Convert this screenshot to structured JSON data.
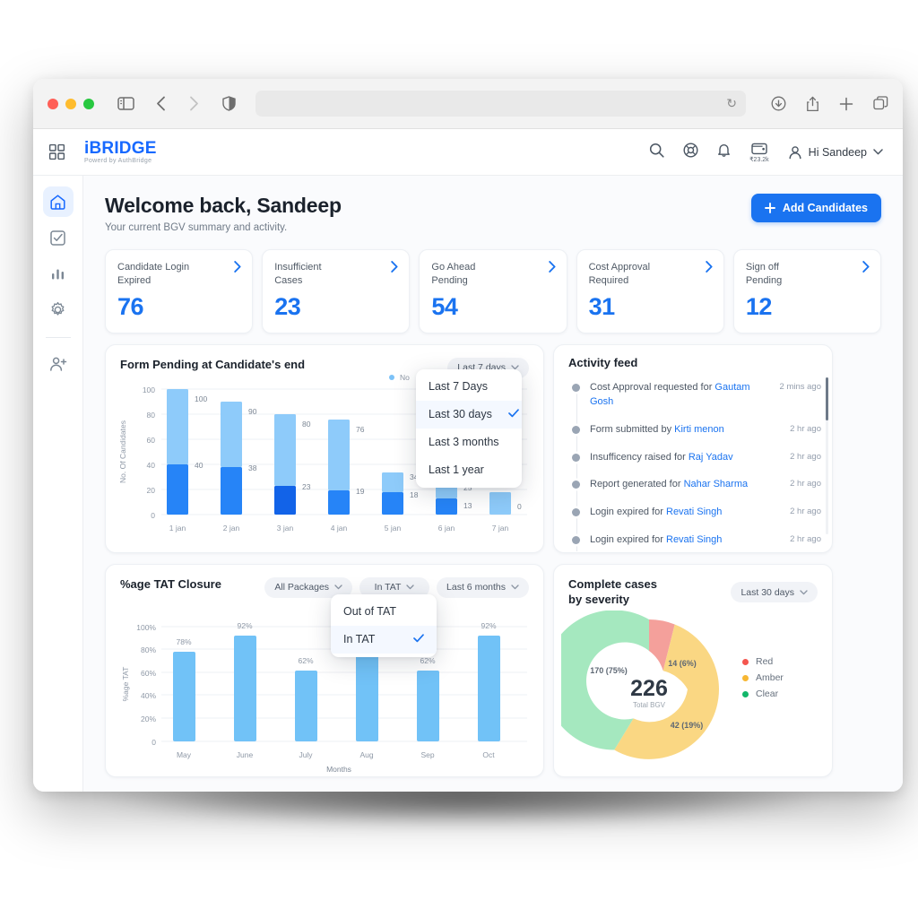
{
  "browser": {
    "url_value": "",
    "reload_icon": "reload-icon",
    "icons": [
      "sidebar-icon",
      "back-icon",
      "forward-icon",
      "shield-icon",
      "download-icon",
      "share-icon",
      "new-tab-icon",
      "tabs-icon"
    ]
  },
  "header": {
    "grid_icon": "grid-icon",
    "brand_name": "iBRIDGE",
    "brand_tagline": "Powerd by AuthBridge",
    "wallet_amount": "₹23.2k",
    "user_greeting": "Hi Sandeep",
    "icons": [
      "search-icon",
      "help-icon",
      "bell-icon",
      "wallet-icon",
      "user-icon",
      "chevron-down-icon"
    ]
  },
  "sidebar": {
    "items": [
      {
        "name": "home",
        "icon": "home-icon",
        "active": true
      },
      {
        "name": "tasks",
        "icon": "checkbox-task-icon",
        "active": false
      },
      {
        "name": "reports",
        "icon": "bar-chart-icon",
        "active": false
      },
      {
        "name": "settings",
        "icon": "gear-icon",
        "active": false
      },
      {
        "name": "add-user",
        "icon": "add-user-icon",
        "active": false
      }
    ]
  },
  "welcome": {
    "title": "Welcome back, Sandeep",
    "subtitle": "Your current BGV summary and activity.",
    "add_button": "Add Candidates"
  },
  "kpis": [
    {
      "label": "Candidate Login\nExpired",
      "value": "76"
    },
    {
      "label": "Insufficient\nCases",
      "value": "23"
    },
    {
      "label": "Go Ahead\nPending",
      "value": "54"
    },
    {
      "label": "Cost Approval\nRequired",
      "value": "31"
    },
    {
      "label": "Sign off\nPending",
      "value": "12"
    }
  ],
  "form_pending": {
    "title": "Form Pending at Candidate's end",
    "range_pill": "Last 7 days",
    "legend_partial": "No",
    "menu": {
      "items": [
        {
          "label": "Last 7 Days",
          "selected": false
        },
        {
          "label": "Last 30 days",
          "selected": true
        },
        {
          "label": "Last 3 months",
          "selected": false
        },
        {
          "label": "Last 1 year",
          "selected": false
        }
      ]
    }
  },
  "activity_feed": {
    "title": "Activity feed",
    "items": [
      {
        "text": "Cost Approval requested for ",
        "who": "Gautam Gosh",
        "time": "2 mins ago"
      },
      {
        "text": "Form submitted by ",
        "who": "Kirti menon",
        "time": "2 hr ago"
      },
      {
        "text": "Insufficency raised for ",
        "who": "Raj Yadav",
        "time": "2 hr ago"
      },
      {
        "text": "Report generated for ",
        "who": "Nahar Sharma",
        "time": "2 hr ago"
      },
      {
        "text": "Login expired for ",
        "who": "Revati  Singh",
        "time": "2 hr ago"
      },
      {
        "text": "Login expired for ",
        "who": "Revati  Singh",
        "time": "2 hr ago"
      }
    ]
  },
  "tat": {
    "title": "%age TAT Closure",
    "pill_packages": "All Packages",
    "pill_tat": "In TAT",
    "pill_range": "Last 6 months",
    "menu": {
      "items": [
        {
          "label": "Out of TAT",
          "selected": false
        },
        {
          "label": "In TAT",
          "selected": true
        }
      ]
    }
  },
  "severity": {
    "title": "Complete cases\nby severity",
    "range_pill": "Last 30 days",
    "center_value": "226",
    "center_label": "Total BGV",
    "legend": [
      {
        "label": "Red",
        "color": "#f4564f"
      },
      {
        "label": "Amber",
        "color": "#f7b733"
      },
      {
        "label": "Clear",
        "color": "#12b76a"
      }
    ]
  },
  "chart_data": [
    {
      "type": "bar",
      "chart_name": "form-pending-stacked-bar",
      "title": "Form Pending at Candidate's end",
      "xlabel": "",
      "ylabel": "No. Of Candidates",
      "ylim": [
        0,
        100
      ],
      "yticks": [
        0,
        20,
        40,
        60,
        80,
        100
      ],
      "grid": true,
      "stacked": true,
      "categories": [
        "1 jan",
        "2 jan",
        "3 jan",
        "4 jan",
        "5 jan",
        "6 jan",
        "7 jan"
      ],
      "series": [
        {
          "name": "lower",
          "color": "#2684f7",
          "values": [
            40,
            38,
            23,
            19,
            18,
            13,
            0
          ]
        },
        {
          "name": "upper",
          "color": "#8ecbfa",
          "values": [
            100,
            90,
            80,
            76,
            34,
            25,
            18
          ]
        }
      ],
      "bar_colors_lower": [
        "#2684f7",
        "#2684f7",
        "#1263e8",
        "#2684f7",
        "#2684f7",
        "#2684f7",
        "#2684f7"
      ],
      "labels_lower": [
        "40",
        "38",
        "23",
        "19",
        "18",
        "13",
        "0"
      ],
      "labels_upper": [
        "100",
        "90",
        "80",
        "76",
        "34",
        "25",
        "18"
      ]
    },
    {
      "type": "bar",
      "chart_name": "tat-closure-bar",
      "title": "%age TAT Closure",
      "xlabel": "Months",
      "ylabel": "%age TAT",
      "ylim": [
        0,
        110
      ],
      "yticks": [
        0,
        20,
        40,
        60,
        80,
        100
      ],
      "ytick_labels": [
        "0",
        "20%",
        "40%",
        "60%",
        "80%",
        "100%"
      ],
      "grid": true,
      "bar_color": "#71c2f7",
      "categories": [
        "May",
        "June",
        "July",
        "Aug",
        "Sep",
        "Oct"
      ],
      "values": [
        78,
        92,
        62,
        75,
        62,
        92
      ],
      "value_labels": [
        "78%",
        "92%",
        "62%",
        "",
        "62%",
        "92%"
      ]
    },
    {
      "type": "pie",
      "chart_name": "severity-donut",
      "title": "Complete cases by severity",
      "total": 226,
      "center_label": "Total BGV",
      "donut": true,
      "legend_position": "right",
      "slices": [
        {
          "label": "Red",
          "value": 14,
          "percent": 6,
          "data_label": "14 (6%)",
          "color": "#f4a09b"
        },
        {
          "label": "Amber",
          "value": 42,
          "percent": 19,
          "data_label": "42 (19%)",
          "color": "#fad783"
        },
        {
          "label": "Clear",
          "value": 170,
          "percent": 75,
          "data_label": "170 (75%)",
          "color": "#a5e8bf"
        }
      ]
    }
  ]
}
